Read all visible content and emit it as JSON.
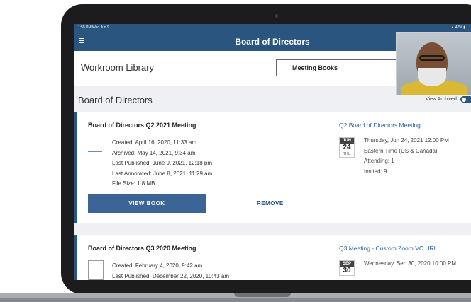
{
  "status_bar": {
    "time": "1:55 PM  Wed Jun 9",
    "battery": "47%"
  },
  "nav": {
    "title": "Board of Directors"
  },
  "library": {
    "title": "Workroom Library",
    "dropdown_value": "Meeting Books"
  },
  "section": {
    "title": "Board of Directors",
    "view_archived_label": "View Archived",
    "view_archived_on": true
  },
  "meetings": [
    {
      "title": "Board of Directors Q2 2021 Meeting",
      "details": [
        "Created: April 16, 2020, 11:33 am",
        "Archived: May 14, 2021, 9:34 am",
        "Last Published: June 9, 2021, 12:18 pm",
        "Last Annotated: June 8, 2021, 11:29 am",
        "File Size: 1.8 MB"
      ],
      "view_label": "VIEW BOOK",
      "remove_label": "REMOVE",
      "event_title": "Q2 Board of Directors Meeting",
      "date": {
        "month": "JUN",
        "day": "24",
        "dow": "THU"
      },
      "event_lines": [
        "Thursday, Jun 24, 2021 12:00 PM",
        "Eastern Time (US & Canada)",
        "Attending: 1",
        "Invited: 9"
      ]
    },
    {
      "title": "Board of Directors Q3 2020 Meeting",
      "details": [
        "Created: February 4, 2020, 9:42 am",
        "Last Published: December 22, 2020, 10:43 am"
      ],
      "event_title": "Q3 Meeting - Custom Zoom VC URL",
      "date": {
        "month": "SEP",
        "day": "30"
      },
      "event_lines": [
        "Wednesday, Sep 30, 2020 10:00 PM"
      ]
    }
  ],
  "colors": {
    "brand": "#2a557e",
    "button": "#3c6597",
    "link": "#2a63a3"
  }
}
